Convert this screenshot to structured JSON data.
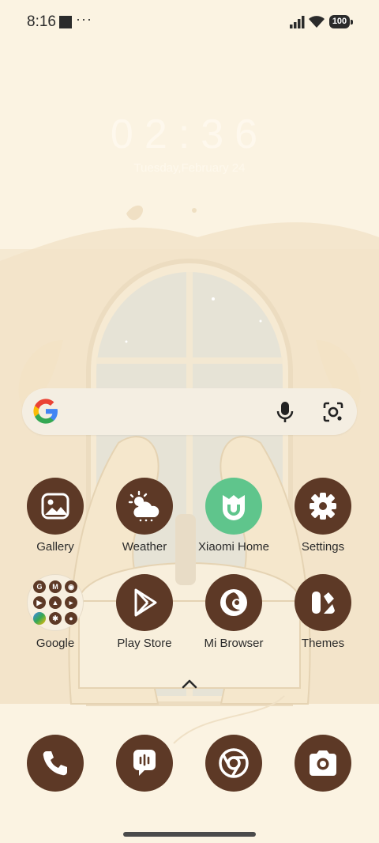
{
  "status": {
    "time": "8:16",
    "more": "···",
    "battery": "100"
  },
  "lockclock": {
    "time": "02:36",
    "date": "Tuesday,February 24"
  },
  "search": {
    "placeholder": ""
  },
  "apps": {
    "gallery": "Gallery",
    "weather": "Weather",
    "xiaomi_home": "Xiaomi Home",
    "settings": "Settings",
    "google": "Google",
    "play_store": "Play Store",
    "mi_browser": "Mi Browser",
    "themes": "Themes"
  },
  "google_folder": [
    "G",
    "M",
    "◉",
    "▶",
    "▲",
    "▸",
    "✦",
    "✱",
    "●"
  ],
  "colors": {
    "icon_bg": "#5d3926",
    "xiaomi_home_bg": "#5fc58c",
    "background": "#fbf3e2"
  }
}
